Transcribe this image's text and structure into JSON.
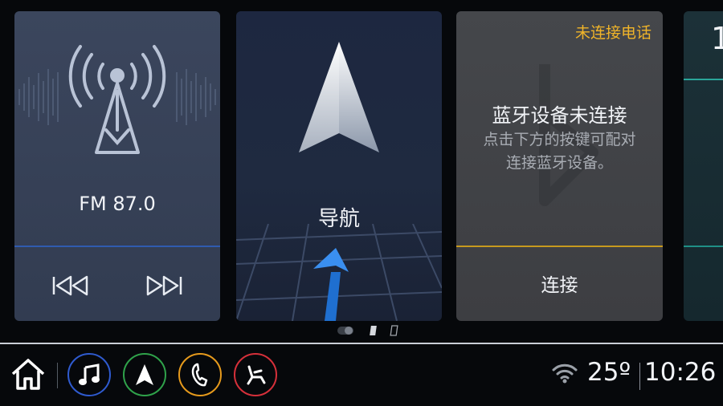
{
  "radio": {
    "frequency": "FM 87.0",
    "prev_icon": "skip-previous-icon",
    "next_icon": "skip-next-icon",
    "accent": "#2f5bb0"
  },
  "navigation": {
    "label": "导航",
    "icon": "navigation-arrow-icon"
  },
  "bluetooth": {
    "status": "未连接电话",
    "title": "蓝牙设备未连接",
    "desc_line1": "点击下方的按键可配对",
    "desc_line2": "连接蓝牙设备。",
    "connect_label": "连接",
    "status_color": "#f0b429",
    "accent": "#c79a1e"
  },
  "partial_card": {
    "text": "1"
  },
  "dock": {
    "home_icon": "home-icon",
    "apps": [
      {
        "name": "music",
        "icon": "music-note-icon",
        "color": "#2f5bd0"
      },
      {
        "name": "navigation",
        "icon": "navigation-icon",
        "color": "#2fa24a"
      },
      {
        "name": "phone",
        "icon": "phone-icon",
        "color": "#e69a1c"
      },
      {
        "name": "seat",
        "icon": "seat-icon",
        "color": "#d6303a"
      }
    ]
  },
  "status_bar": {
    "wifi_icon": "wifi-icon",
    "temperature": "25º",
    "time": "10:26"
  }
}
